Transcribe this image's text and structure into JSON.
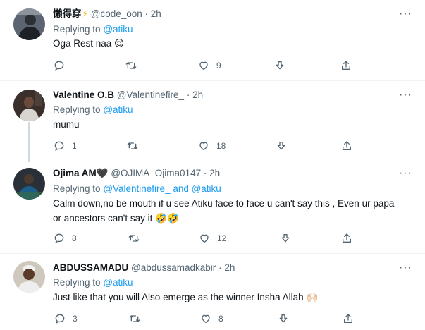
{
  "tweets": [
    {
      "name": "懶得穿",
      "name_emoji": "⚡",
      "handle": "@code_oon",
      "time": "2h",
      "replying_label": "Replying to",
      "mentions": "@atiku",
      "text_lines": [
        "Oga Rest naa 😌"
      ],
      "replies": "",
      "retweets": "",
      "likes": "9"
    },
    {
      "name": "Valentine O.B",
      "name_emoji": "",
      "handle": "@Valentinefire_",
      "time": "2h",
      "replying_label": "Replying to",
      "mentions": "@atiku",
      "text_lines": [
        "mumu"
      ],
      "replies": "1",
      "retweets": "",
      "likes": "18"
    },
    {
      "name": "Ojima AM",
      "name_emoji": "🖤",
      "handle": "@OJIMA_Ojima0147",
      "time": "2h",
      "replying_label": "Replying to",
      "mentions": "@Valentinefire_ and @atiku",
      "text_lines": [
        "Calm down,no be mouth if u see Atiku face to face u can't say this , Even ur papa",
        "or ancestors can't say it 🤣🤣"
      ],
      "replies": "8",
      "retweets": "",
      "likes": "12"
    },
    {
      "name": "ABDUSSAMADU",
      "name_emoji": "",
      "handle": "@abdussamadkabir",
      "time": "2h",
      "replying_label": "Replying to",
      "mentions": "@atiku",
      "text_lines": [
        "Just like that you will Also emerge as the winner Insha Allah 🙌🏻"
      ],
      "replies": "3",
      "retweets": "",
      "likes": "8"
    }
  ],
  "dot_separator": "·",
  "more_glyph": "···",
  "icons": {
    "reply": "reply-icon",
    "retweet": "retweet-icon",
    "like": "like-icon",
    "download": "download-icon",
    "share": "share-icon",
    "more": "more-icon"
  },
  "colors": {
    "text": "#0f1419",
    "muted": "#536471",
    "link": "#1d9bf0",
    "divider": "#eff3f4",
    "thread_line": "#cfd9de"
  }
}
